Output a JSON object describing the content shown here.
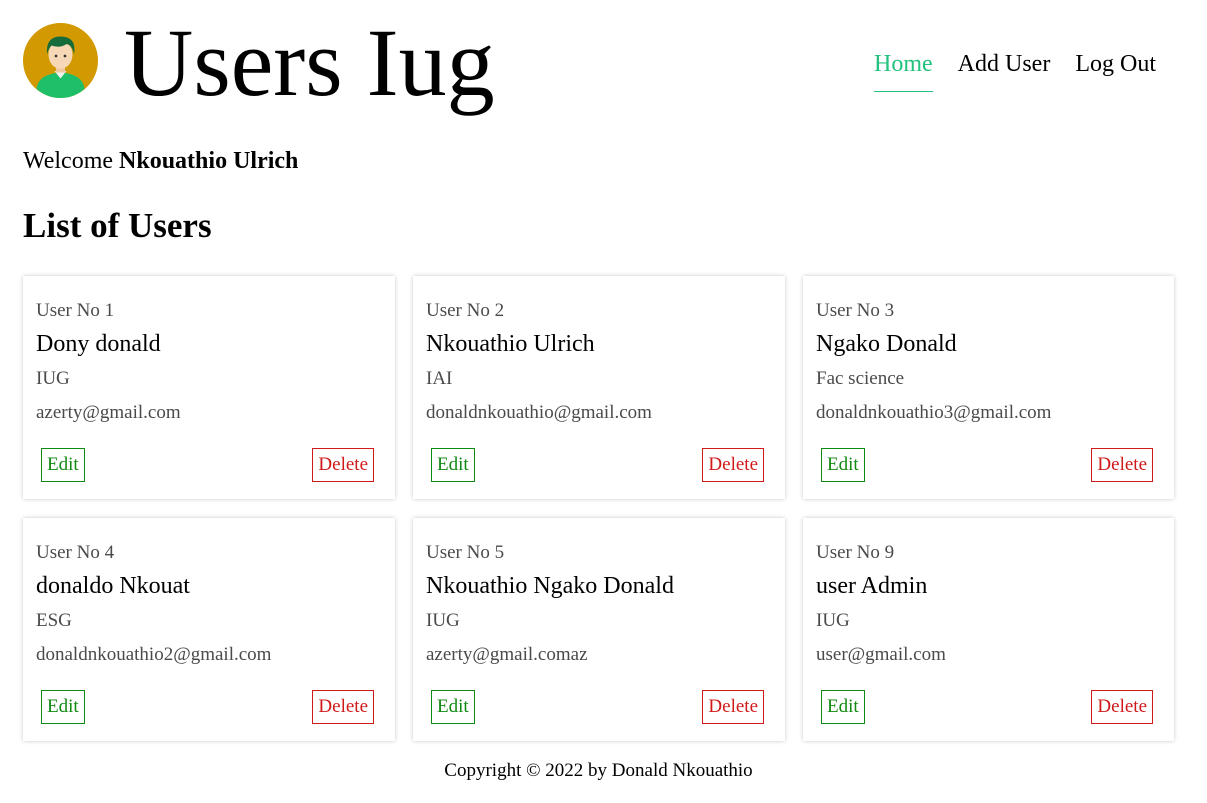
{
  "header": {
    "title": "Users Iug",
    "logo": "user-avatar-icon",
    "nav": [
      {
        "label": "Home",
        "active": true
      },
      {
        "label": "Add User",
        "active": false
      },
      {
        "label": "Log Out",
        "active": false
      }
    ]
  },
  "welcome": {
    "prefix": "Welcome",
    "user": "Nkouathio Ulrich"
  },
  "list_title": "List of Users",
  "users": [
    {
      "no_label": "User No 1",
      "name": "Dony donald",
      "org": "IUG",
      "email": "azerty@gmail.com",
      "edit": "Edit",
      "delete": "Delete"
    },
    {
      "no_label": "User No 2",
      "name": "Nkouathio Ulrich",
      "org": "IAI",
      "email": "donaldnkouathio@gmail.com",
      "edit": "Edit",
      "delete": "Delete"
    },
    {
      "no_label": "User No 3",
      "name": "Ngako Donald",
      "org": "Fac science",
      "email": "donaldnkouathio3@gmail.com",
      "edit": "Edit",
      "delete": "Delete"
    },
    {
      "no_label": "User No 4",
      "name": "donaldo Nkouat",
      "org": "ESG",
      "email": "donaldnkouathio2@gmail.com",
      "edit": "Edit",
      "delete": "Delete"
    },
    {
      "no_label": "User No 5",
      "name": "Nkouathio Ngako Donald",
      "org": "IUG",
      "email": "azerty@gmail.comaz",
      "edit": "Edit",
      "delete": "Delete"
    },
    {
      "no_label": "User No 9",
      "name": "user Admin",
      "org": "IUG",
      "email": "user@gmail.com",
      "edit": "Edit",
      "delete": "Delete"
    }
  ],
  "footer": "Copyright © 2022 by Donald Nkouathio",
  "colors": {
    "accent": "#21c27d",
    "edit": "#118a11",
    "delete": "#d01919",
    "avatar_bg": "#d29a00"
  }
}
